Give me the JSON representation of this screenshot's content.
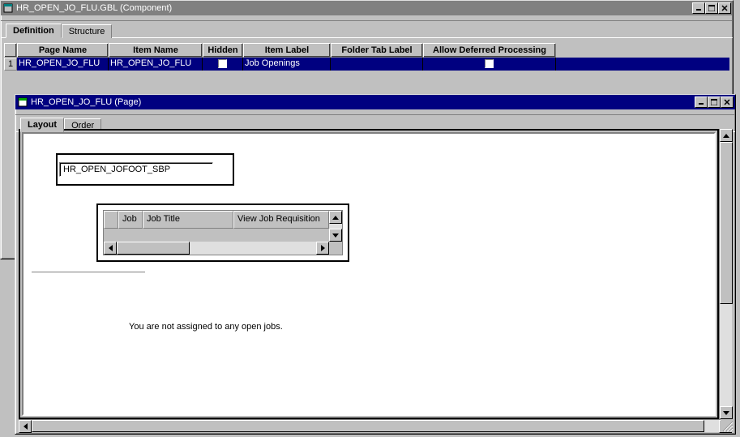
{
  "outer_window": {
    "title": "HR_OPEN_JO_FLU.GBL (Component)",
    "tabs": {
      "definition": "Definition",
      "structure": "Structure"
    },
    "grid": {
      "headers": {
        "page_name": "Page Name",
        "item_name": "Item Name",
        "hidden": "Hidden",
        "item_label": "Item Label",
        "folder_tab_label": "Folder Tab Label",
        "allow_deferred": "Allow Deferred Processing"
      },
      "rows": [
        {
          "num": "1",
          "page_name": "HR_OPEN_JO_FLU",
          "item_name": "HR_OPEN_JO_FLU",
          "hidden": false,
          "item_label": "Job Openings",
          "folder_tab_label": "",
          "allow_deferred": false
        }
      ]
    }
  },
  "inner_window": {
    "title": "HR_OPEN_JO_FLU (Page)",
    "tabs": {
      "layout": "Layout",
      "order": "Order"
    },
    "subpage_name": "HR_OPEN_JOFOOT_SBP",
    "inner_grid_headers": {
      "col1": "",
      "job": "Job",
      "job_title": "Job Title",
      "view_req": "View Job Requisition"
    },
    "message": "You are not assigned to any open jobs."
  }
}
